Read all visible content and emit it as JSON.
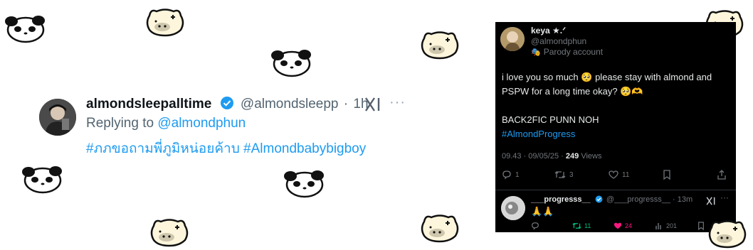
{
  "reply_tweet": {
    "display_name": "almondsleepalltime",
    "handle": "@almondsleepp",
    "separator": "·",
    "time_ago": "1h",
    "replying_prefix": "Replying to",
    "replying_to": "@almondphun",
    "hashtags": "#ภภขอถามพี่ภูมิหน่อยค้าบ #Almondbabybigboy",
    "more_glyph": "···",
    "verified_color": "#1d9bf0"
  },
  "embedded_post": {
    "display_name": "keya ★.ᐟ",
    "handle": "@almondphun",
    "parody_label": "Parody account",
    "body_line1": "i love you so much 🥺 please stay with almond and PSPW for a long time okay? 🥺🫶",
    "body_line2": "BACK2FIC PUNN NOH",
    "hashtag": "#AlmondProgress",
    "timestamp": "09.43 · 09/05/25 ·",
    "views_count": "249",
    "views_label": "Views",
    "replies": "1",
    "reposts": "3",
    "likes": "11"
  },
  "reply_post": {
    "display_name": "___progresss__",
    "handle": "@___progresss__",
    "separator": "·",
    "time_ago": "13m",
    "text": "🙏🙏",
    "reposts": "11",
    "likes": "24",
    "views": "201",
    "more_glyph": "···"
  },
  "colors": {
    "link": "#1d9bf0",
    "repost_active": "#00ba7c",
    "like_active": "#f91880",
    "card_background": "#000000"
  },
  "icons": [
    "verified-badge-icon",
    "xai-logo-icon",
    "more-icon",
    "reply-icon",
    "repost-icon",
    "like-icon",
    "bookmark-icon",
    "share-icon",
    "views-icon",
    "parody-mask-icon",
    "panda-sticker",
    "piglet-sticker"
  ]
}
